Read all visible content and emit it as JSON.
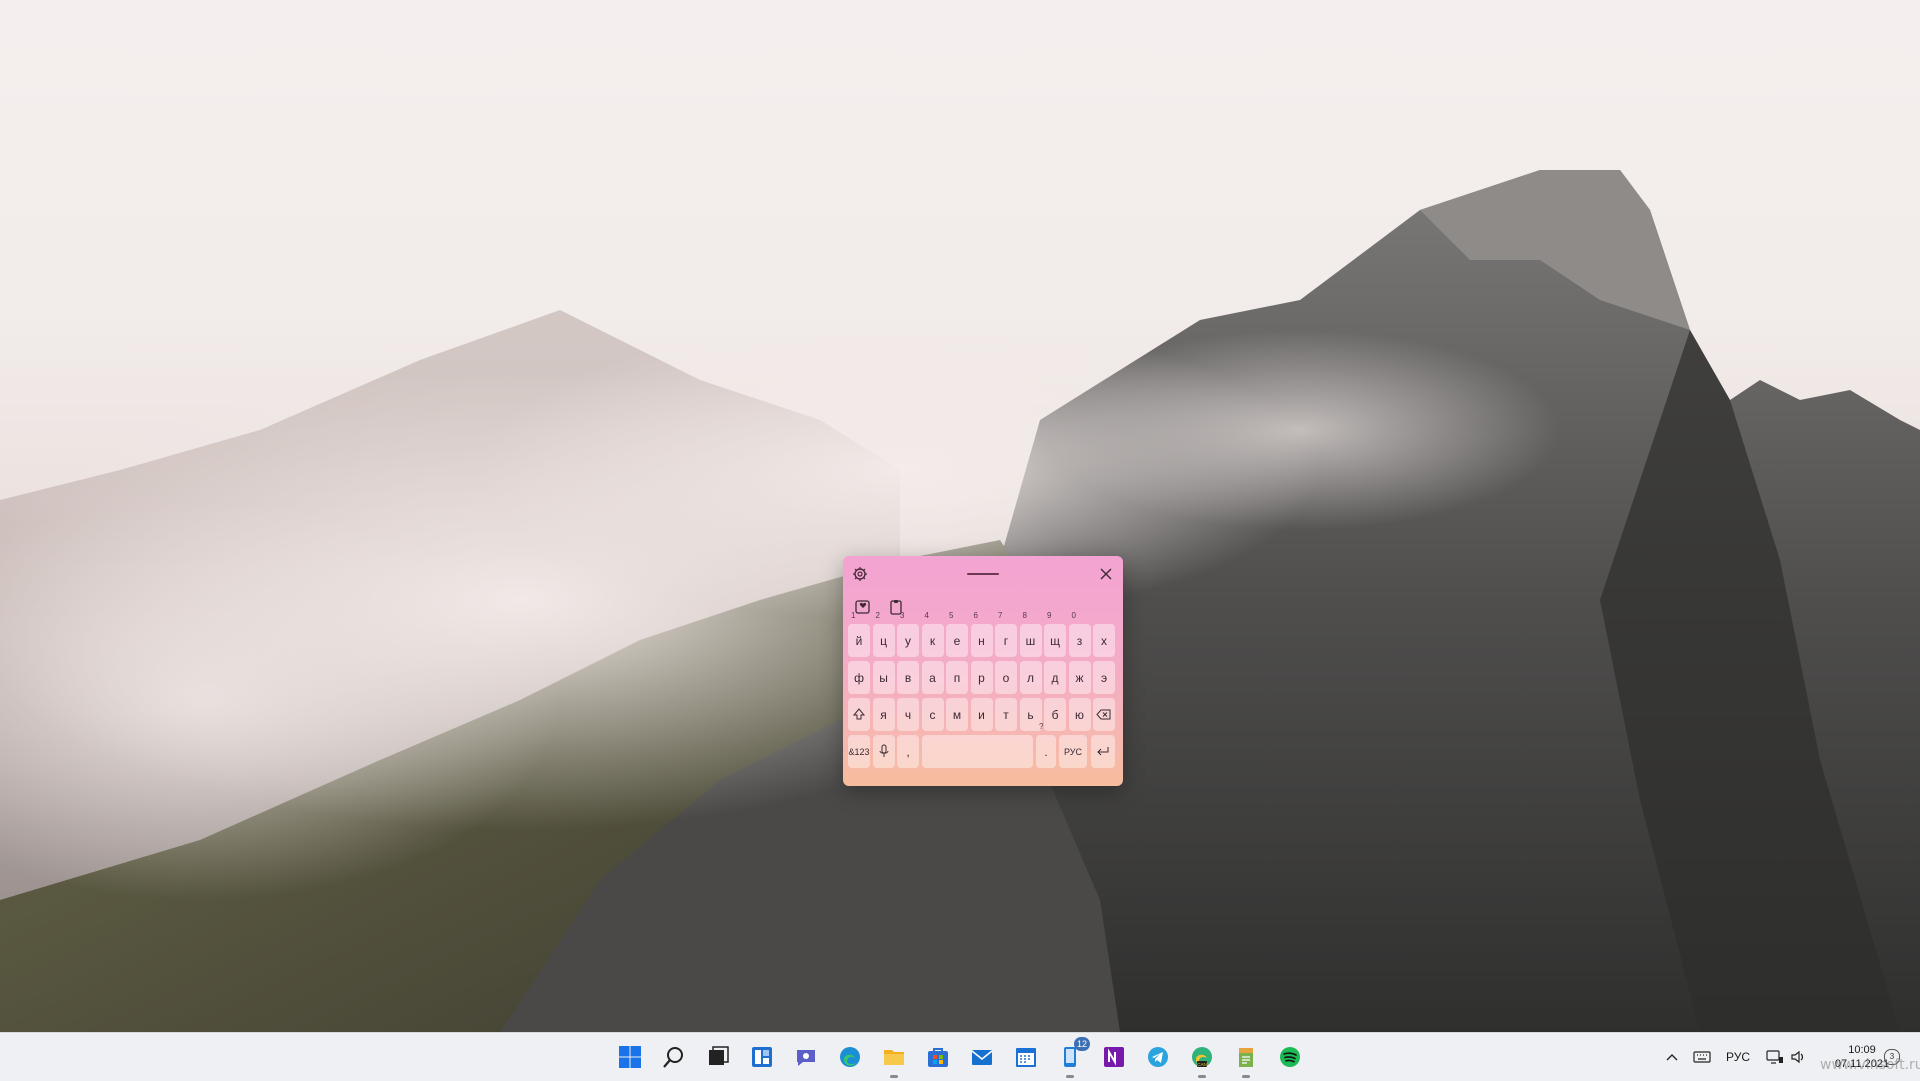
{
  "desktop": {
    "wallpaper": "mountain-fog"
  },
  "touch_keyboard": {
    "theme": {
      "top": "#f3a3d2",
      "bottom": "#f6bd9d"
    },
    "rows": [
      {
        "keys": [
          {
            "label": "й",
            "hint": "1"
          },
          {
            "label": "ц",
            "hint": "2"
          },
          {
            "label": "у",
            "hint": "3"
          },
          {
            "label": "к",
            "hint": "4"
          },
          {
            "label": "е",
            "hint": "5"
          },
          {
            "label": "н",
            "hint": "6"
          },
          {
            "label": "г",
            "hint": "7"
          },
          {
            "label": "ш",
            "hint": "8"
          },
          {
            "label": "щ",
            "hint": "9"
          },
          {
            "label": "з",
            "hint": "0"
          },
          {
            "label": "х",
            "hint": ""
          }
        ]
      },
      {
        "keys": [
          {
            "label": "ф"
          },
          {
            "label": "ы"
          },
          {
            "label": "в"
          },
          {
            "label": "а"
          },
          {
            "label": "п"
          },
          {
            "label": "р"
          },
          {
            "label": "о"
          },
          {
            "label": "л"
          },
          {
            "label": "д"
          },
          {
            "label": "ж"
          },
          {
            "label": "э"
          }
        ]
      },
      {
        "keys": [
          {
            "label": "я"
          },
          {
            "label": "ч"
          },
          {
            "label": "с"
          },
          {
            "label": "м"
          },
          {
            "label": "и"
          },
          {
            "label": "т"
          },
          {
            "label": "ь"
          },
          {
            "label": "б"
          },
          {
            "label": "ю"
          }
        ]
      }
    ],
    "bottom_row": {
      "symbols": "&123",
      "comma": ",",
      "period": ".",
      "period_hint": "?",
      "lang": "РУС"
    }
  },
  "taskbar": {
    "pinned": [
      {
        "name": "start",
        "color": "#1a73e8"
      },
      {
        "name": "search",
        "color": "#222222"
      },
      {
        "name": "task-view",
        "color": "#222222"
      },
      {
        "name": "widgets",
        "color": "#1f6fd1"
      },
      {
        "name": "chat",
        "color": "#5b5fc7"
      },
      {
        "name": "edge",
        "color": "#1b8fd6"
      },
      {
        "name": "file-explorer",
        "color": "#f2b01e"
      },
      {
        "name": "store",
        "color": "#2a6fd6"
      },
      {
        "name": "mail",
        "color": "#1670d0"
      },
      {
        "name": "calendar",
        "color": "#1a73d4"
      },
      {
        "name": "phone-link",
        "color": "#1f7fd8",
        "badge": "12"
      },
      {
        "name": "onenote",
        "color": "#7719aa"
      },
      {
        "name": "telegram",
        "color": "#2aa3de"
      },
      {
        "name": "edge-canary",
        "color": "#2fb37a",
        "overlay": "CAN"
      },
      {
        "name": "notepad-app",
        "color": "#7bb24b"
      },
      {
        "name": "spotify",
        "color": "#1db954"
      }
    ],
    "tray": {
      "lang": "РУС",
      "time": "10:09",
      "date": "07.11.2021",
      "notifications": "3"
    }
  },
  "watermark": "www.vinsoft.ru"
}
